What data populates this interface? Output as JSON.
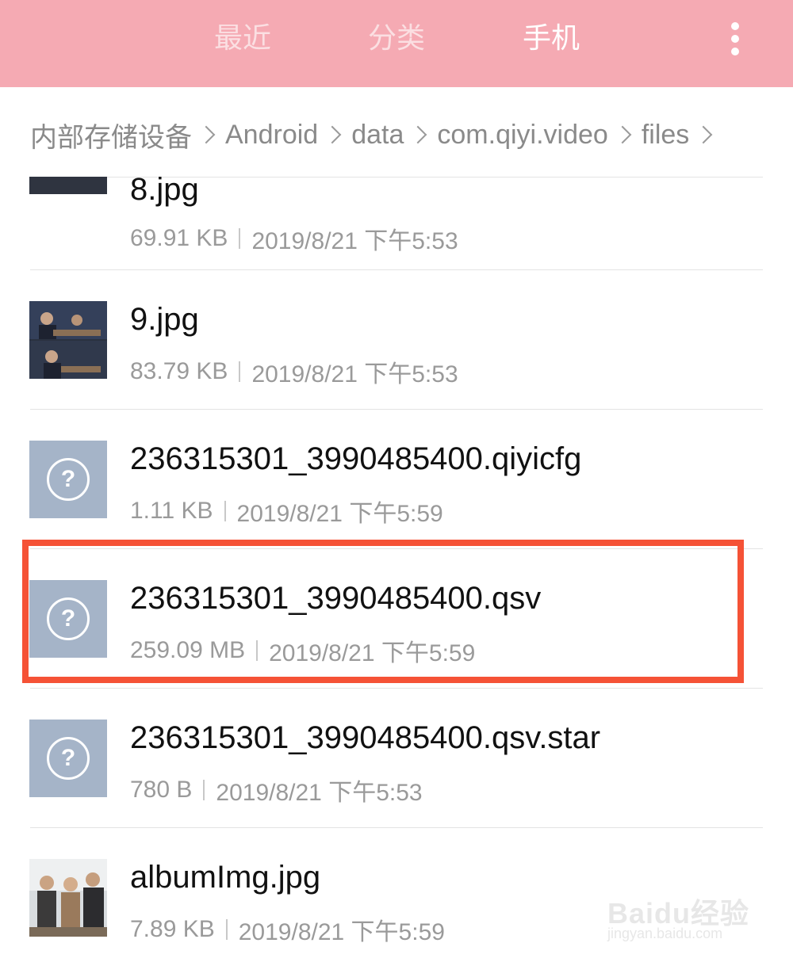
{
  "topbar": {
    "tabs": [
      {
        "label": "最近",
        "active": false
      },
      {
        "label": "分类",
        "active": false
      },
      {
        "label": "手机",
        "active": true
      }
    ],
    "more_icon": "more-vertical-icon",
    "background": "#f5aab3"
  },
  "breadcrumb": [
    "内部存储设备",
    "Android",
    "data",
    "com.qiyi.video",
    "files"
  ],
  "files": [
    {
      "name": "8.jpg",
      "size": "69.91 KB",
      "date": "2019/8/21 下午5:53",
      "icon": "image-thumbnail"
    },
    {
      "name": "9.jpg",
      "size": "83.79 KB",
      "date": "2019/8/21 下午5:53",
      "icon": "image-thumbnail"
    },
    {
      "name": "236315301_3990485400.qiyicfg",
      "size": "1.11 KB",
      "date": "2019/8/21 下午5:59",
      "icon": "unknown-file-icon",
      "icon_glyph": "?"
    },
    {
      "name": "236315301_3990485400.qsv",
      "size": "259.09 MB",
      "date": "2019/8/21 下午5:59",
      "icon": "unknown-file-icon",
      "icon_glyph": "?",
      "highlighted": true
    },
    {
      "name": "236315301_3990485400.qsv.star",
      "size": "780 B",
      "date": "2019/8/21 下午5:53",
      "icon": "unknown-file-icon",
      "icon_glyph": "?"
    },
    {
      "name": "albumImg.jpg",
      "size": "7.89 KB",
      "date": "2019/8/21 下午5:59",
      "icon": "image-thumbnail"
    }
  ],
  "watermark": {
    "main": "Baidu经验",
    "sub": "jingyan.baidu.com"
  },
  "colors": {
    "highlight": "#f55236",
    "unknown_icon_bg": "#a5b4c8"
  }
}
